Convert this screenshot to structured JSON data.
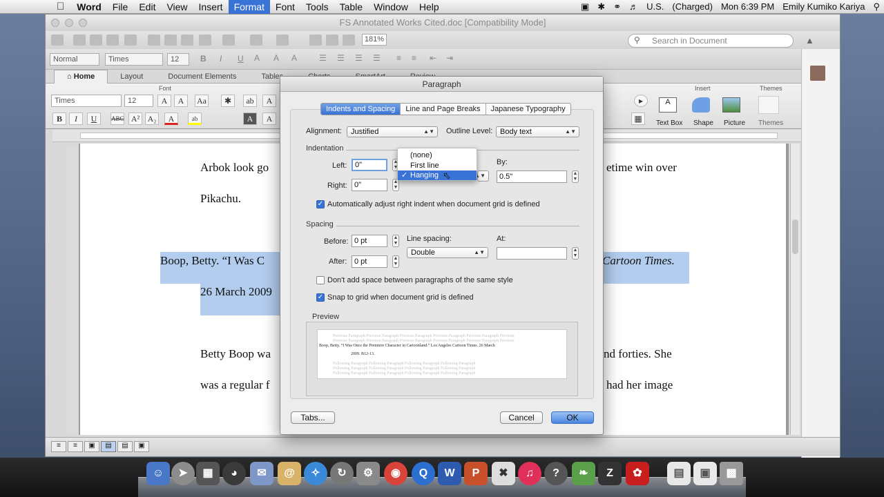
{
  "menubar": {
    "app": "Word",
    "items": [
      "File",
      "Edit",
      "View",
      "Insert",
      "Format",
      "Font",
      "Tools",
      "Table",
      "Window",
      "Help"
    ],
    "active": "Format",
    "input_source": "U.S.",
    "battery": "(Charged)",
    "clock": "Mon 6:39 PM",
    "user": "Emily Kumiko Kariya"
  },
  "window": {
    "title": "FS Annotated Works Cited.doc [Compatibility Mode]",
    "zoom": "181%",
    "search_placeholder": "Search in Document"
  },
  "format_bar": {
    "style": "Normal",
    "font": "Times",
    "size": "12"
  },
  "ribbon": {
    "tabs": [
      "Home",
      "Layout",
      "Document Elements",
      "Tables",
      "Charts",
      "SmartArt",
      "Review"
    ],
    "selected": "Home",
    "font_group_label": "Font",
    "font": "Times",
    "size": "12",
    "insert_label": "Insert",
    "themes_label": "Themes",
    "text_box": "Text Box",
    "shape": "Shape",
    "picture": "Picture",
    "themes": "Themes"
  },
  "document": {
    "line1_start": "Arbok look go",
    "line1_end": "etime win over",
    "line2": "Pikachu.",
    "line3_start": "Boop, Betty. “I Was C",
    "line3_end": "Cartoon Times.",
    "line4": "26 March 2009",
    "line5_start": "Betty Boop wa",
    "line5_end": "nd forties.  She",
    "line6_start": "was a regular f",
    "line6_end": "had her image"
  },
  "dialog": {
    "title": "Paragraph",
    "tabs": [
      "Indents and Spacing",
      "Line and Page Breaks",
      "Japanese Typography"
    ],
    "selected_tab": "Indents and Spacing",
    "alignment_label": "Alignment:",
    "alignment": "Justified",
    "outline_label": "Outline Level:",
    "outline": "Body text",
    "indentation_label": "Indentation",
    "left_label": "Left:",
    "left": "0\"",
    "right_label": "Right:",
    "right": "0\"",
    "by_label": "By:",
    "by": "0.5\"",
    "auto_adjust": "Automatically adjust right indent when document grid is defined",
    "spacing_label": "Spacing",
    "before_label": "Before:",
    "before": "0 pt",
    "after_label": "After:",
    "after": "0 pt",
    "line_spacing_label": "Line spacing:",
    "line_spacing": "Double",
    "at_label": "At:",
    "at": "",
    "dont_add": "Don't add space between paragraphs of the same style",
    "snap": "Snap to grid when document grid is defined",
    "preview_label": "Preview",
    "preview_prev": "Previous Paragraph Previous Paragraph Previous Paragraph Previous Paragraph Previous Paragraph Previous",
    "preview_text": "Boop, Betty. “I Was Once the Premiere Character in Cartoonland.” Los Angeles Cartoon Times. 26 March",
    "preview_text2": "2009. B12-13.",
    "preview_next": "Following Paragraph Following Paragraph Following Paragraph Following Paragraph",
    "tabs_button": "Tabs...",
    "cancel": "Cancel",
    "ok": "OK"
  },
  "special_menu": {
    "options": [
      "(none)",
      "First line",
      "Hanging"
    ],
    "selected": "Hanging"
  },
  "colors": {
    "accent": "#3a73d6",
    "highlight": "#b3cdef"
  }
}
